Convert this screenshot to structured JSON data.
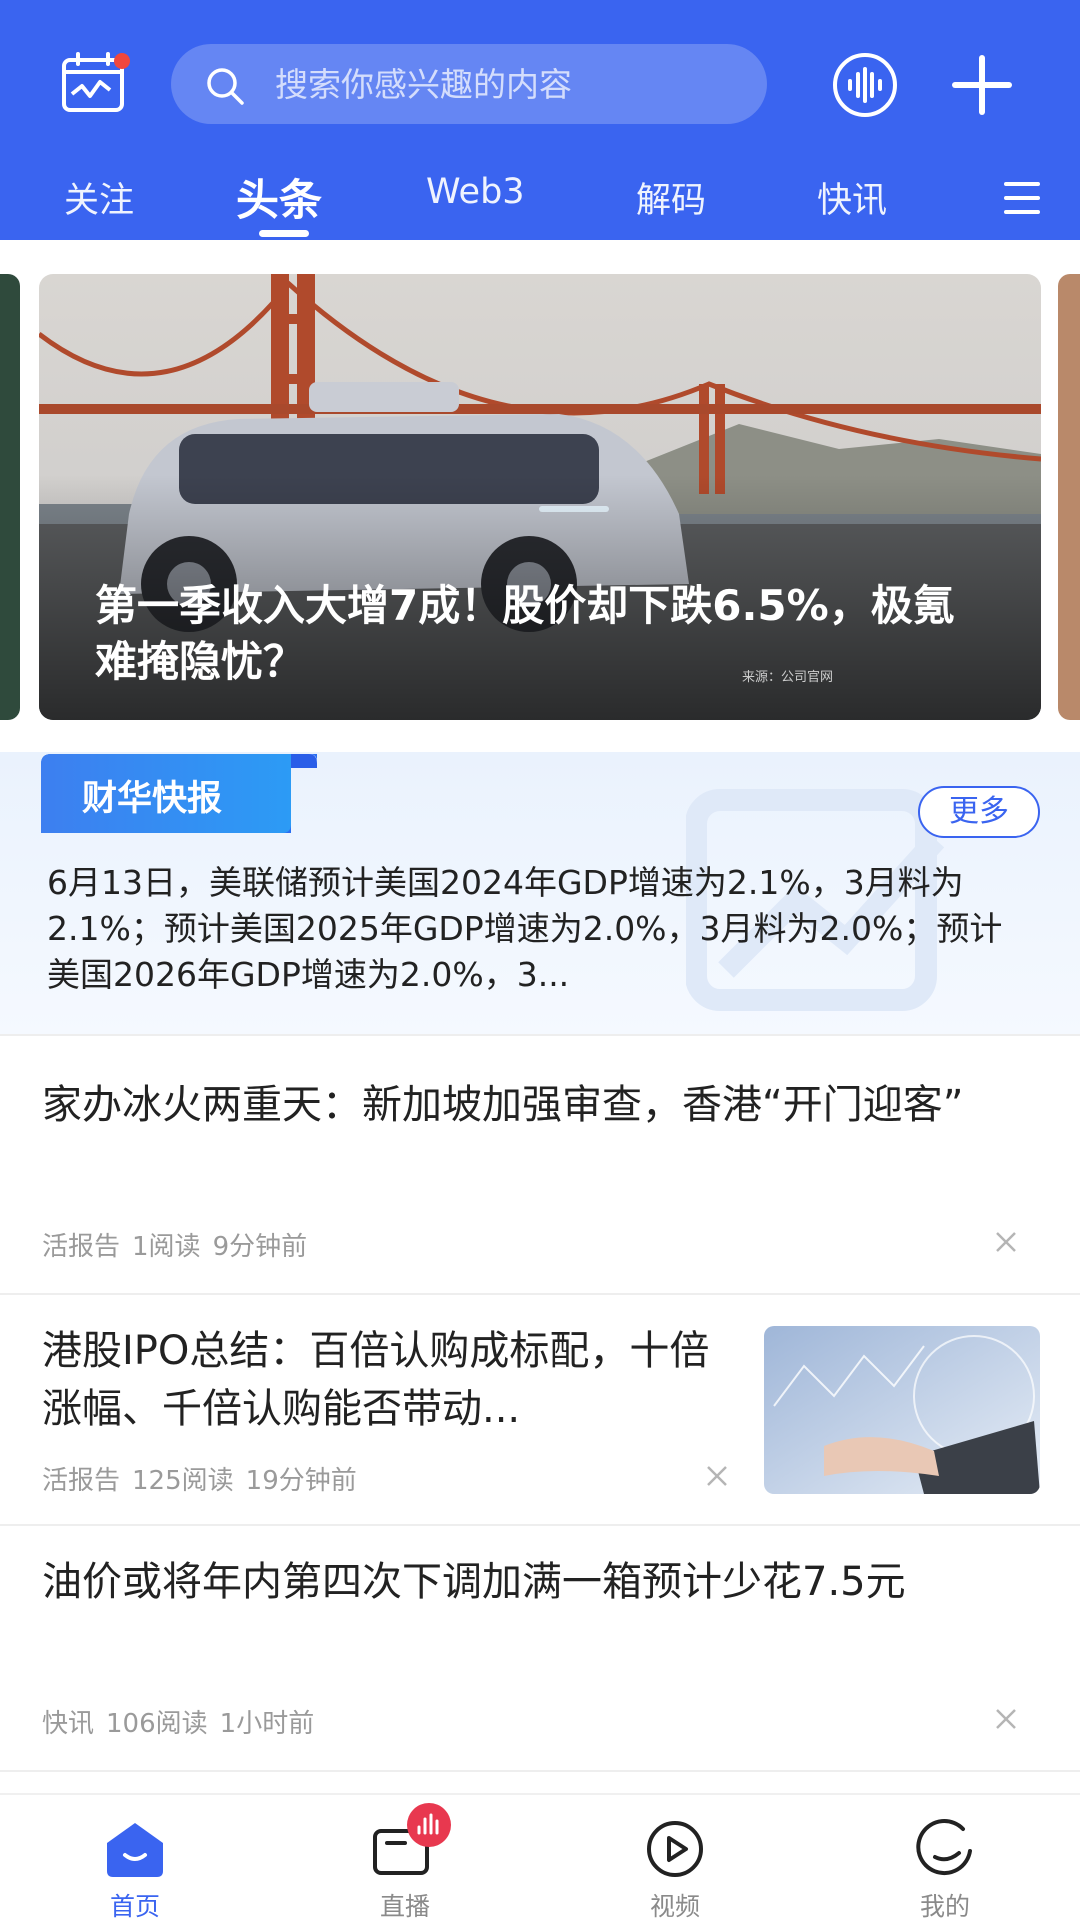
{
  "colors": {
    "primary": "#3a64f0",
    "live_badge": "#e8384f"
  },
  "header": {
    "calendar_icon": "calendar-chart-icon",
    "search": {
      "placeholder": "搜索你感兴趣的内容",
      "icon": "search-icon"
    },
    "voice_icon": "voice-wave-icon",
    "plus_icon": "plus-icon"
  },
  "tabs": [
    {
      "label": "关注",
      "active": false
    },
    {
      "label": "头条",
      "active": true
    },
    {
      "label": "Web3",
      "active": false
    },
    {
      "label": "解码",
      "active": false
    },
    {
      "label": "快讯",
      "active": false
    }
  ],
  "menu_icon": "menu-icon",
  "banner": {
    "title": "第一季收入大增7成！股价却下跌6.5%，极氪难掩隐忧？",
    "source": "来源：公司官网"
  },
  "flash": {
    "badge": "财华快报",
    "more": "更多",
    "text": "6月13日，美联储预计美国2024年GDP增速为2.1%，3月料为2.1%；预计美国2025年GDP增速为2.0%，3月料为2.0%；预计美国2026年GDP增速为2.0%，3..."
  },
  "news": [
    {
      "title": "家办冰火两重天：新加坡加强审查，香港“开门迎客”",
      "source": "活报告",
      "reads": "1阅读",
      "time": "9分钟前"
    },
    {
      "title": "港股IPO总结：百倍认购成标配，十倍涨幅、千倍认购能否带动...",
      "source": "活报告",
      "reads": "125阅读",
      "time": "19分钟前"
    },
    {
      "title": "油价或将年内第四次下调加满一箱预计少花7.5元",
      "source": "快讯",
      "reads": "106阅读",
      "time": "1小时前"
    }
  ],
  "bottom_nav": [
    {
      "label": "首页",
      "icon": "home-icon",
      "active": true
    },
    {
      "label": "直播",
      "icon": "live-icon",
      "active": false
    },
    {
      "label": "视频",
      "icon": "video-play-icon",
      "active": false
    },
    {
      "label": "我的",
      "icon": "profile-icon",
      "active": false
    }
  ]
}
